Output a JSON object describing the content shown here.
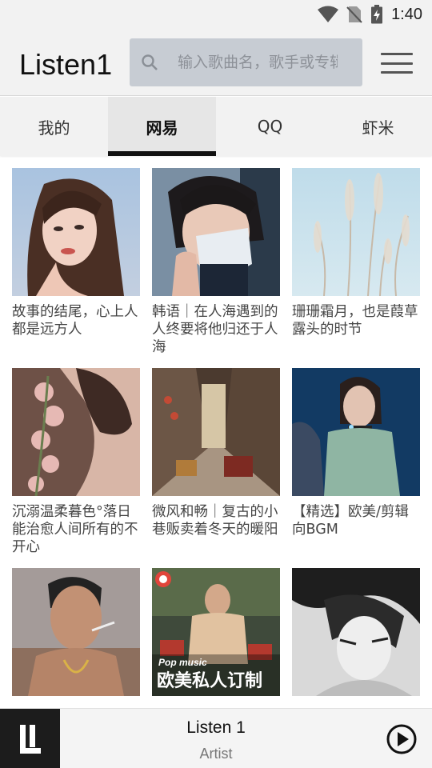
{
  "status_bar": {
    "time": "1:40",
    "icons": [
      "wifi-icon",
      "no-sim-icon",
      "battery-charging-icon"
    ]
  },
  "app_bar": {
    "title": "Listen1",
    "search": {
      "placeholder": "输入歌曲名，歌手或专辑",
      "value": ""
    },
    "menu_icon": "hamburger-menu-icon"
  },
  "tabs": [
    {
      "label": "我的",
      "active": false
    },
    {
      "label": "网易",
      "active": true
    },
    {
      "label": "QQ",
      "active": false
    },
    {
      "label": "虾米",
      "active": false
    }
  ],
  "playlists": [
    {
      "title": "故事的结尾，心上人都是远方人"
    },
    {
      "title": "韩语｜在人海遇到的人终要将他归还于人海"
    },
    {
      "title": "珊珊霜月，也是葭草露头的时节"
    },
    {
      "title": "沉溺温柔暮色°落日能治愈人间所有的不开心"
    },
    {
      "title": "微风和畅｜复古的小巷贩卖着冬天的暖阳"
    },
    {
      "title": "【精选】欧美/剪辑向BGM"
    },
    {
      "title": ""
    },
    {
      "title": "",
      "cover_text_top": "Pop music",
      "cover_text_main": "欧美私人订制"
    },
    {
      "title": ""
    }
  ],
  "player": {
    "title": "Listen 1",
    "artist": "Artist"
  }
}
